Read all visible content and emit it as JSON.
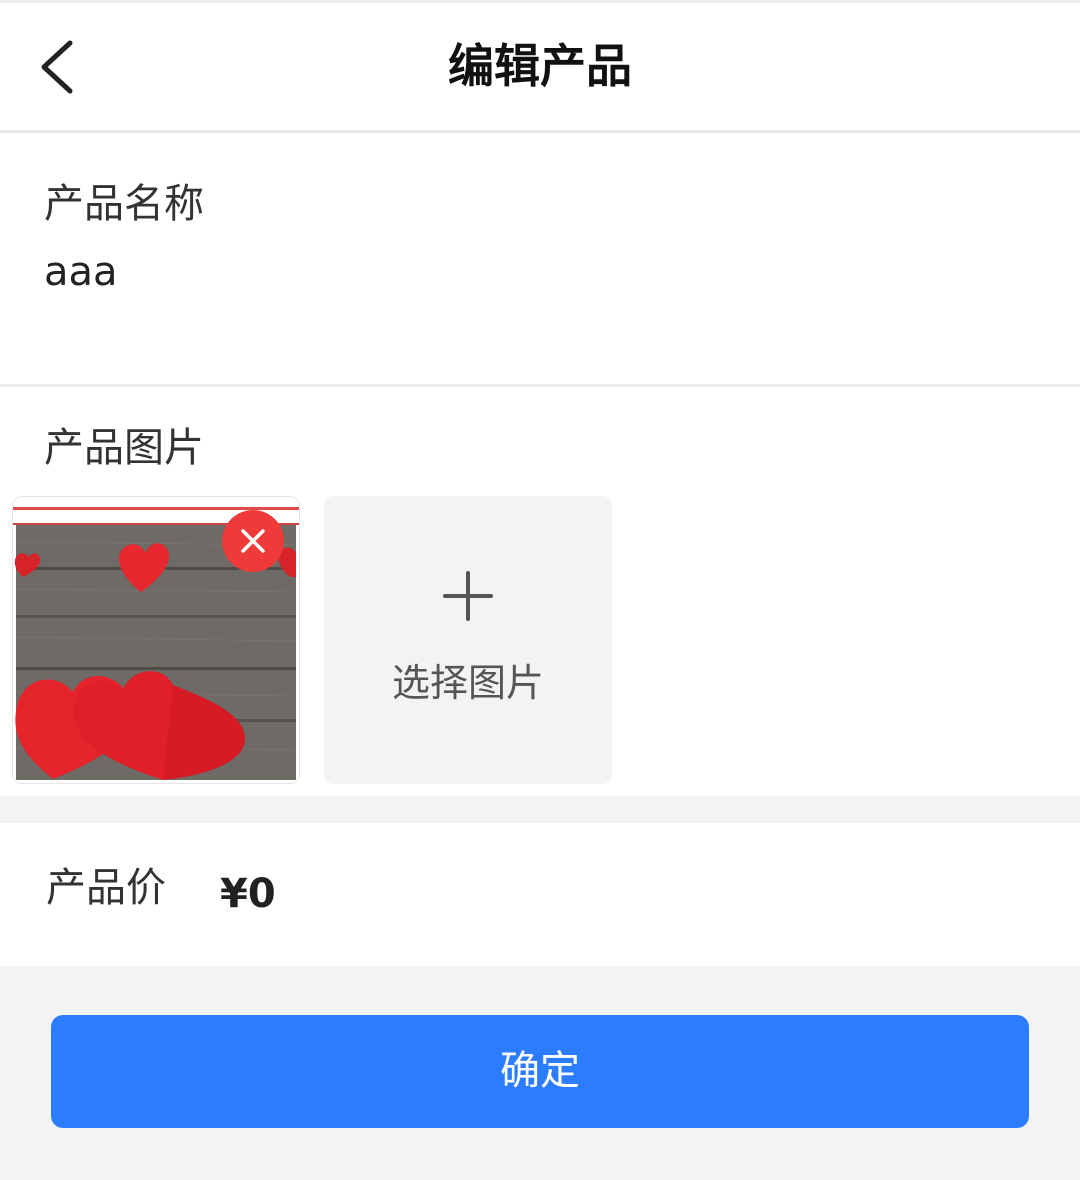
{
  "header": {
    "title": "编辑产品",
    "back_icon": "chevron-left-icon"
  },
  "name_field": {
    "label": "产品名称",
    "value": "aaa"
  },
  "image_field": {
    "label": "产品图片",
    "thumbnail_alt": "red felt hearts on wooden boards",
    "delete_icon": "close-icon",
    "select_icon": "plus-icon",
    "select_label": "选择图片"
  },
  "price_field": {
    "label": "产品价",
    "value": "¥0"
  },
  "confirm_label": "确定",
  "colors": {
    "accent": "#2b7cff",
    "delete": "#f03a3a",
    "background": "#f2f3f5"
  }
}
